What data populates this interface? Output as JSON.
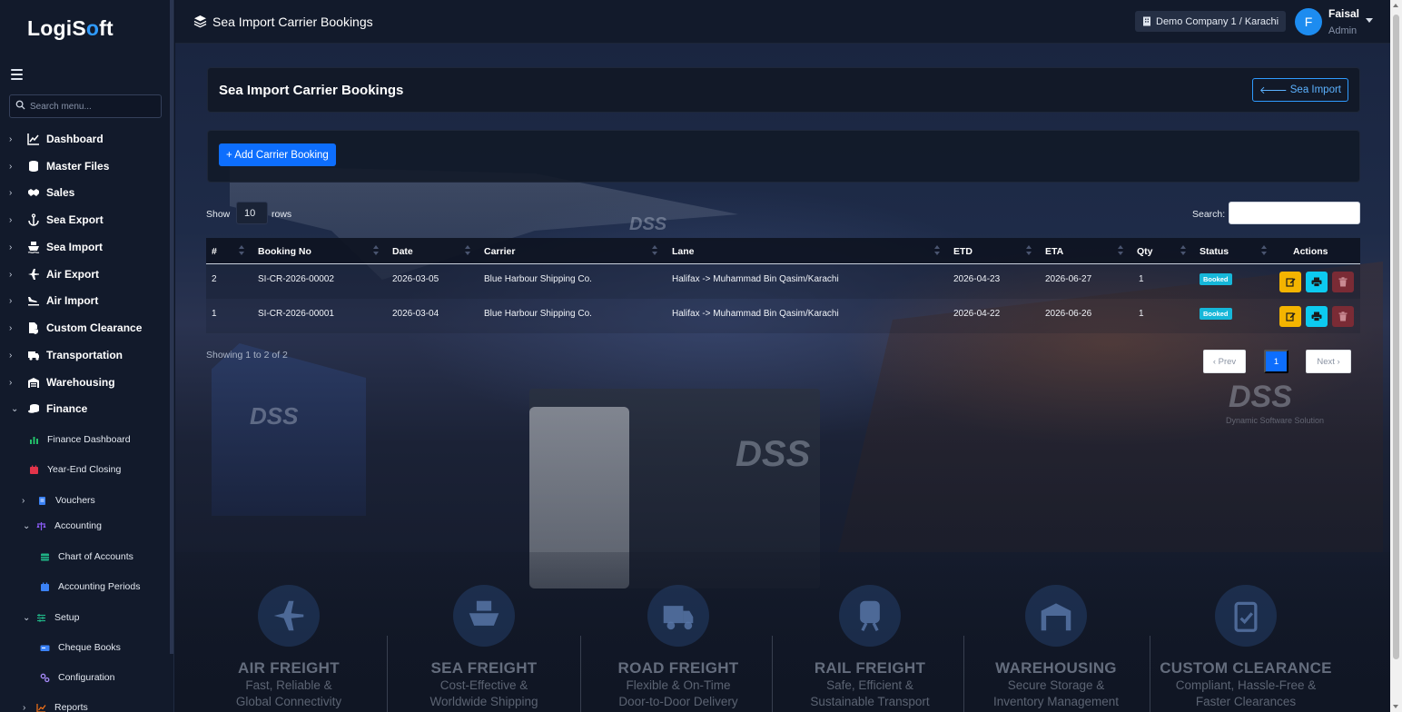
{
  "app": {
    "logo_main": "LogiS",
    "logo_accent": "o",
    "logo_tail": "ft"
  },
  "sidebar": {
    "search_placeholder": "Search menu...",
    "items": [
      {
        "label": "Dashboard",
        "icon": "chart-line-icon"
      },
      {
        "label": "Master Files",
        "icon": "database-icon"
      },
      {
        "label": "Sales",
        "icon": "handshake-icon"
      },
      {
        "label": "Sea Export",
        "icon": "anchor-icon"
      },
      {
        "label": "Sea Import",
        "icon": "ship-icon"
      },
      {
        "label": "Air Export",
        "icon": "plane-icon"
      },
      {
        "label": "Air Import",
        "icon": "plane-arrival-icon"
      },
      {
        "label": "Custom Clearance",
        "icon": "file-shield-icon"
      },
      {
        "label": "Transportation",
        "icon": "truck-icon"
      },
      {
        "label": "Warehousing",
        "icon": "warehouse-icon"
      },
      {
        "label": "Finance",
        "icon": "coins-icon"
      }
    ],
    "finance_children": {
      "finance_dashboard": "Finance Dashboard",
      "year_end_closing": "Year-End Closing",
      "vouchers": "Vouchers",
      "accounting": "Accounting",
      "chart_of_accounts": "Chart of Accounts",
      "accounting_periods": "Accounting Periods",
      "setup": "Setup",
      "cheque_books": "Cheque Books",
      "configuration": "Configuration",
      "reports": "Reports"
    }
  },
  "topbar": {
    "title": "Sea Import Carrier Bookings",
    "company": "Demo Company 1 / Karachi",
    "avatar_initial": "F",
    "user_name": "Faisal",
    "user_role": "Admin"
  },
  "page": {
    "title": "Sea Import Carrier Bookings",
    "back_label": "Sea Import",
    "add_label": "+ Add Carrier Booking",
    "show_label": "Show",
    "rows_value": "10",
    "rows_label": "rows",
    "search_label": "Search:",
    "showing_text": "Showing 1 to 2 of 2",
    "pagination": {
      "prev": "‹ Prev",
      "current": "1",
      "next": "Next ›"
    }
  },
  "table": {
    "headers": [
      "#",
      "Booking No",
      "Date",
      "Carrier",
      "Lane",
      "ETD",
      "ETA",
      "Qty",
      "Status",
      "Actions"
    ],
    "rows": [
      {
        "num": "2",
        "booking_no": "SI-CR-2026-00002",
        "date": "2026-03-05",
        "carrier": "Blue Harbour Shipping Co.",
        "lane": "Halifax -> Muhammad Bin Qasim/Karachi",
        "etd": "2026-04-23",
        "eta": "2026-06-27",
        "qty": "1",
        "status": "Booked"
      },
      {
        "num": "1",
        "booking_no": "SI-CR-2026-00001",
        "date": "2026-03-04",
        "carrier": "Blue Harbour Shipping Co.",
        "lane": "Halifax -> Muhammad Bin Qasim/Karachi",
        "etd": "2026-04-22",
        "eta": "2026-06-26",
        "qty": "1",
        "status": "Booked"
      }
    ]
  },
  "background": {
    "watermark": "DSS",
    "watermark_sub": "Dynamic Software Solution",
    "services": [
      {
        "title": "AIR FREIGHT",
        "line1": "Fast, Reliable &",
        "line2": "Global Connectivity",
        "icon": "plane-icon"
      },
      {
        "title": "SEA FREIGHT",
        "line1": "Cost-Effective &",
        "line2": "Worldwide Shipping",
        "icon": "ship-icon"
      },
      {
        "title": "ROAD FREIGHT",
        "line1": "Flexible & On-Time",
        "line2": "Door-to-Door Delivery",
        "icon": "truck-icon"
      },
      {
        "title": "RAIL FREIGHT",
        "line1": "Safe, Efficient &",
        "line2": "Sustainable Transport",
        "icon": "train-icon"
      },
      {
        "title": "WAREHOUSING",
        "line1": "Secure Storage &",
        "line2": "Inventory Management",
        "icon": "warehouse-icon"
      },
      {
        "title": "CUSTOM CLEARANCE",
        "line1": "Compliant, Hassle-Free &",
        "line2": "Faster Clearances",
        "icon": "clipboard-check-icon"
      }
    ]
  },
  "colors": {
    "primary": "#0d6efd",
    "info": "#0dcaf0",
    "warning": "#f4b400",
    "danger": "#7a2b35",
    "badge": "#16b7d9"
  }
}
